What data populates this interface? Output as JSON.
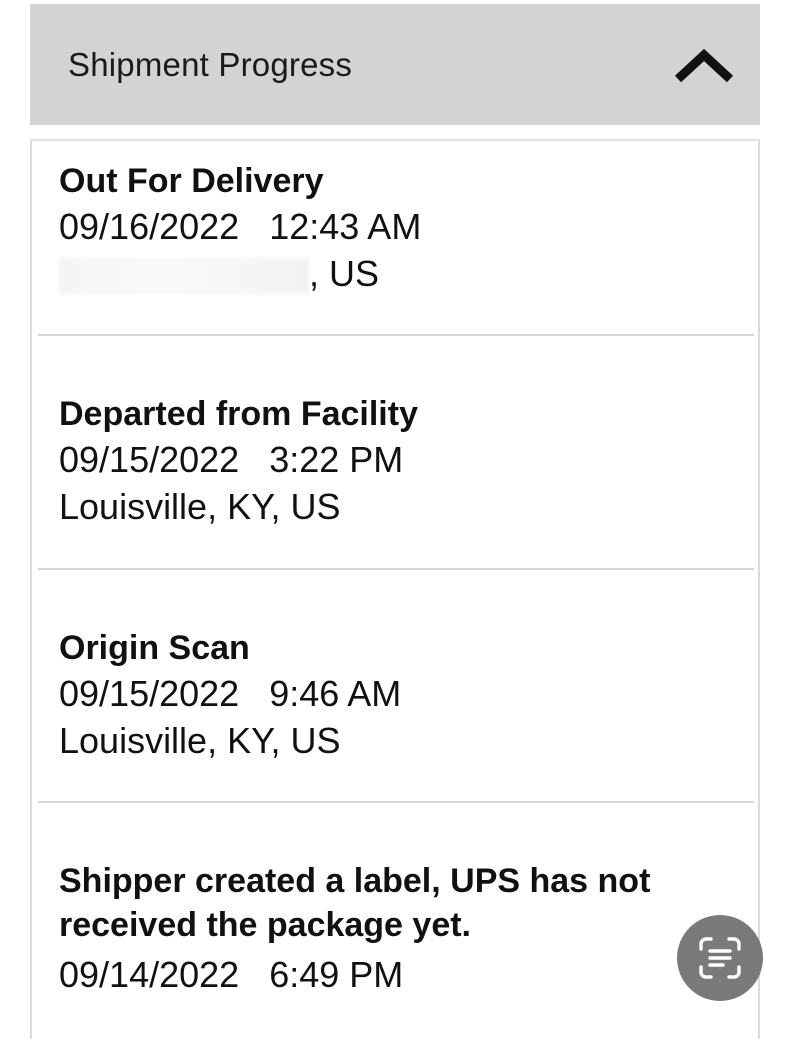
{
  "panel": {
    "title": "Shipment Progress",
    "collapse_icon": "chevron-up-icon"
  },
  "events": [
    {
      "title": "Out For Delivery",
      "date": "09/16/2022",
      "time": "12:43 AM",
      "location": ", US",
      "location_redacted": true
    },
    {
      "title": "Departed from Facility",
      "date": "09/15/2022",
      "time": "3:22 PM",
      "location": "Louisville, KY, US"
    },
    {
      "title": "Origin Scan",
      "date": "09/15/2022",
      "time": "9:46 AM",
      "location": "Louisville, KY, US"
    },
    {
      "title": "Shipper created a label, UPS has not received the package yet.",
      "date": "09/14/2022",
      "time": "6:49 PM"
    }
  ],
  "fab": {
    "icon": "text-scan-icon",
    "color": "#7a7a7a"
  }
}
